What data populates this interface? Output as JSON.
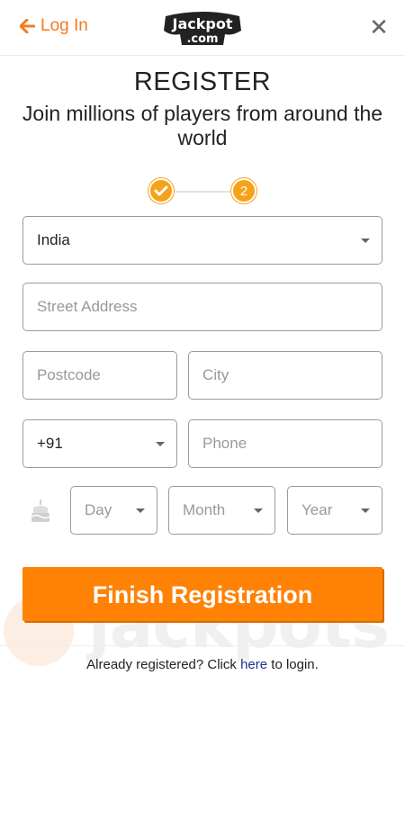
{
  "header": {
    "login_label": "Log In",
    "logo_text_top": "Jackpot",
    "logo_text_bottom": ".com",
    "close_label": "✕"
  },
  "page": {
    "title": "REGISTER",
    "subtitle": "Join millions of players from around the world"
  },
  "steps": {
    "step1_icon": "check-icon",
    "step2_label": "2"
  },
  "form": {
    "country_value": "India",
    "street_placeholder": "Street Address",
    "postcode_placeholder": "Postcode",
    "city_placeholder": "City",
    "dial_code_value": "+91",
    "phone_placeholder": "Phone",
    "day_label": "Day",
    "month_label": "Month",
    "year_label": "Year",
    "birthday_icon": "cake-icon"
  },
  "actions": {
    "finish_label": "Finish Registration"
  },
  "footer": {
    "already_prefix": "Already registered? Click",
    "here_label": "here",
    "already_suffix": "to login."
  },
  "watermark": {
    "text": "jackpots"
  },
  "colors": {
    "accent": "#f47a20",
    "button": "#ff8205",
    "step": "#f7a21b",
    "link": "#1a2f8c"
  }
}
